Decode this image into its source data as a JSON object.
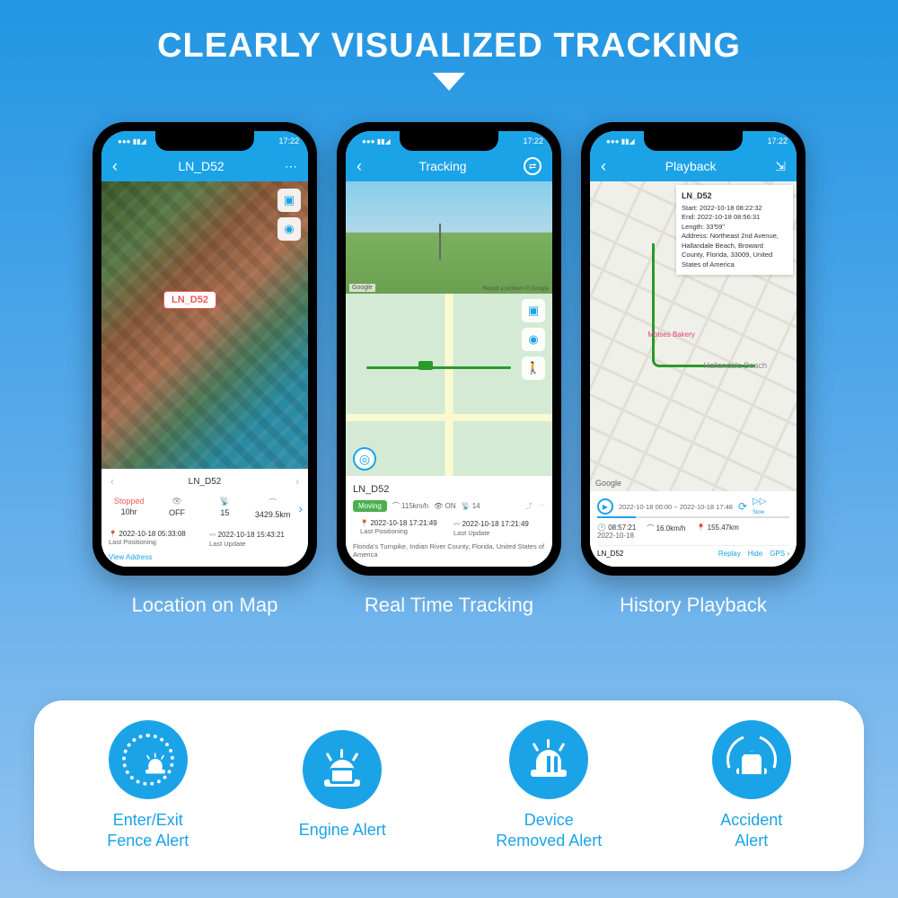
{
  "headline": "CLEARLY VISUALIZED TRACKING",
  "phones": [
    {
      "caption": "Location on Map",
      "status_time": "17:22",
      "header_title": "LN_D52",
      "map_tag": "LN_D52",
      "device_name": "LN_D52",
      "stats": {
        "status": "Stopped",
        "status_val": "10hr",
        "ignition": "OFF",
        "sat": "15",
        "odo": "3429.5km"
      },
      "last_pos": "2022-10-18 05:33:08",
      "last_pos_lbl": "Last Positioning",
      "last_upd": "2022-10-18 15:43:21",
      "last_upd_lbl": "Last Update",
      "view_address": "View Address"
    },
    {
      "caption": "Real Time Tracking",
      "status_time": "17:22",
      "header_title": "Tracking",
      "google": "Google",
      "report": "Report a problem  © Google",
      "device_name": "LN_D52",
      "moving": "Moving",
      "speed": "115km/h",
      "ignition": "ON",
      "sat": "14",
      "last_pos": "2022-10-18 17:21:49",
      "last_pos_lbl": "Last Positioning",
      "last_upd": "2022-10-18 17:21:49",
      "last_upd_lbl": "Last Update",
      "address": "Florida's Turnpike, Indian River County, Florida, United States of America"
    },
    {
      "caption": "History Playback",
      "status_time": "17:22",
      "header_title": "Playback",
      "poi1": "Moises Bakery",
      "poi2": "Hallandale Beach",
      "google": "Google",
      "info": {
        "name": "LN_D52",
        "start_lbl": "Start:",
        "start_val": "2022-10-18 08:22:32",
        "end_lbl": "End:",
        "end_val": "2022-10-18 08:56:31",
        "length_lbl": "Length:",
        "length_val": "33'59\"",
        "addr_lbl": "Address:",
        "addr_val": "Northeast 2nd Avenue, Hallandale Beach, Broward County, Florida, 33009, United States of America"
      },
      "time_range": "2022-10-18 00:00 ~ 2022-10-18 17:48",
      "slow": "Slow",
      "clock": "08:57:21",
      "clock_date": "2022-10-18",
      "speed": "16.0km/h",
      "dist": "155.47km",
      "device_name": "LN_D52",
      "ctrl_replay": "Replay",
      "ctrl_hide": "Hide",
      "ctrl_gps": "GPS"
    }
  ],
  "features": [
    {
      "label": "Enter/Exit\nFence Alert"
    },
    {
      "label": "Engine Alert"
    },
    {
      "label": "Device\nRemoved Alert"
    },
    {
      "label": "Accident\nAlert"
    }
  ]
}
